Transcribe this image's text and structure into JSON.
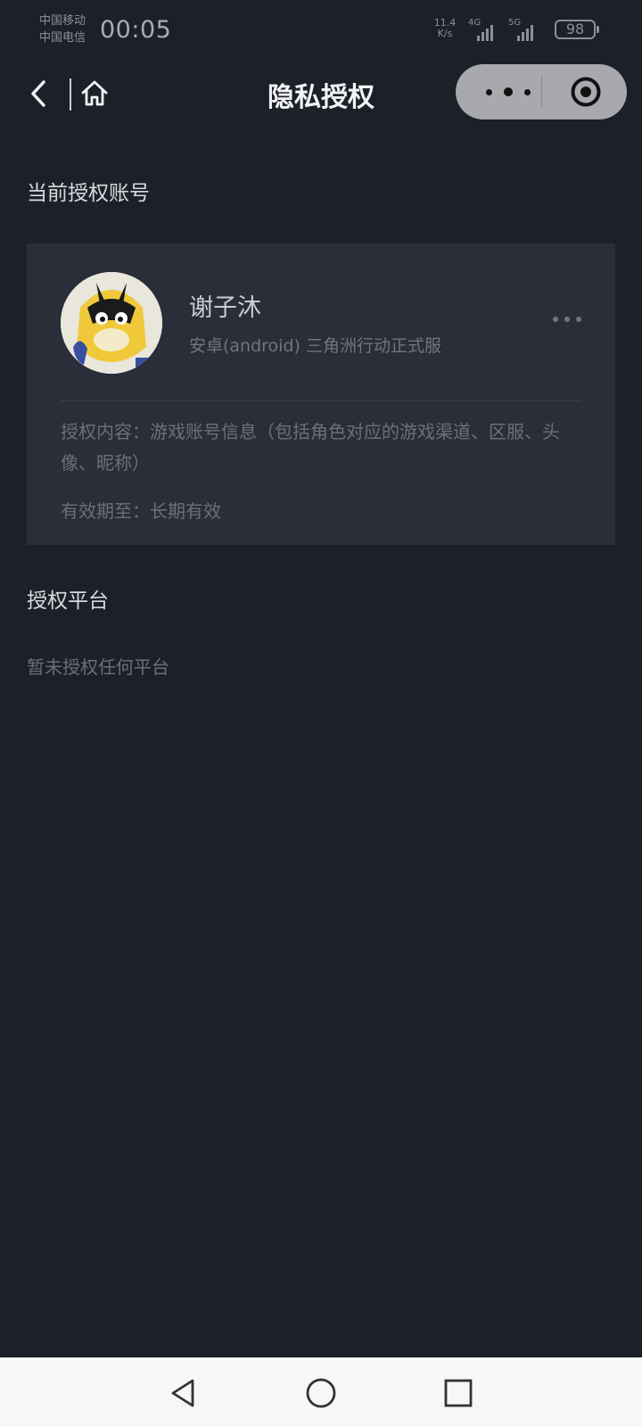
{
  "status_bar": {
    "carrier_1": "中国移动",
    "carrier_2": "中国电信",
    "time": "00:05",
    "net_speed_value": "11.4",
    "net_speed_unit": "K/s",
    "signal_1": "4G",
    "signal_2": "5G",
    "battery": "98"
  },
  "nav": {
    "title": "隐私授权",
    "back_icon": "chevron-left-icon",
    "home_icon": "home-icon",
    "more_icon": "more-dots-icon",
    "close_icon": "target-circle-icon"
  },
  "current_account": {
    "section_title": "当前授权账号",
    "name": "谢子沐",
    "subtitle": "安卓(android) 三角洲行动正式服",
    "auth_content": "授权内容：游戏账号信息（包括角色对应的游戏渠道、区服、头像、昵称）",
    "valid_until": "有效期至：长期有效"
  },
  "platforms": {
    "section_title": "授权平台",
    "empty_text": "暂未授权任何平台"
  },
  "system_nav": {
    "back_icon": "triangle-back-icon",
    "home_icon": "circle-home-icon",
    "recents_icon": "square-recents-icon"
  },
  "colors": {
    "background": "#1d2028",
    "card": "#292e39",
    "capsule": "#a7a9ad",
    "system_nav": "#f7f7f7"
  }
}
